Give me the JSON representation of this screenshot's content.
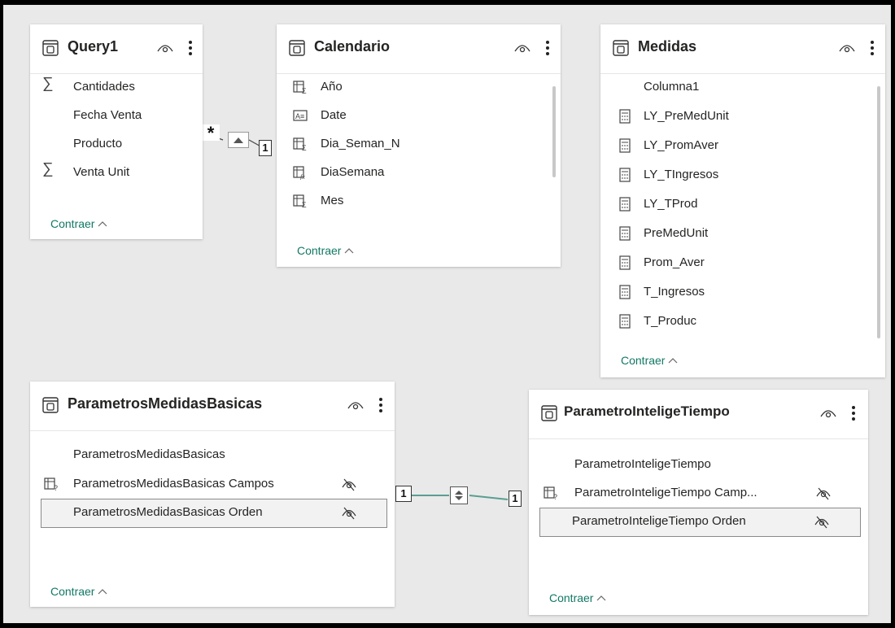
{
  "tables": {
    "query1": {
      "title": "Query1",
      "fields": [
        {
          "label": "Cantidades",
          "icon": "sigma-icon"
        },
        {
          "label": "Fecha Venta",
          "icon": ""
        },
        {
          "label": "Producto",
          "icon": ""
        },
        {
          "label": "Venta Unit",
          "icon": "sigma-icon"
        }
      ],
      "collapse": "Contraer"
    },
    "calendario": {
      "title": "Calendario",
      "fields": [
        {
          "label": "Año",
          "icon": "calculated-column-icon"
        },
        {
          "label": "Date",
          "icon": "text-field-icon"
        },
        {
          "label": "Dia_Seman_N",
          "icon": "calculated-column-icon"
        },
        {
          "label": "DiaSemana",
          "icon": "formula-column-icon"
        },
        {
          "label": "Mes",
          "icon": "calculated-column-icon"
        }
      ],
      "collapse": "Contraer"
    },
    "medidas": {
      "title": "Medidas",
      "fields": [
        {
          "label": "Columna1",
          "icon": ""
        },
        {
          "label": "LY_PreMedUnit",
          "icon": "measure-icon"
        },
        {
          "label": "LY_PromAver",
          "icon": "measure-icon"
        },
        {
          "label": "LY_TIngresos",
          "icon": "measure-icon"
        },
        {
          "label": "LY_TProd",
          "icon": "measure-icon"
        },
        {
          "label": "PreMedUnit",
          "icon": "measure-icon"
        },
        {
          "label": "Prom_Aver",
          "icon": "measure-icon"
        },
        {
          "label": "T_Ingresos",
          "icon": "measure-icon"
        },
        {
          "label": "T_Produc",
          "icon": "measure-icon"
        }
      ],
      "collapse": "Contraer"
    },
    "parametros_medidas_basicas": {
      "title": "ParametrosMedidasBasicas",
      "fields": [
        {
          "label": "ParametrosMedidasBasicas",
          "icon": "",
          "hidden": false
        },
        {
          "label": "ParametrosMedidasBasicas Campos",
          "icon": "field-parameter-icon",
          "hidden": true
        },
        {
          "label": "ParametrosMedidasBasicas Orden",
          "icon": "",
          "hidden": true,
          "selected": true
        }
      ],
      "collapse": "Contraer"
    },
    "parametro_intelige_tiempo": {
      "title": "ParametroInteligeTiempo",
      "fields": [
        {
          "label": "ParametroInteligeTiempo",
          "icon": "",
          "hidden": false
        },
        {
          "label": "ParametroInteligeTiempo Camp...",
          "icon": "field-parameter-icon",
          "hidden": true
        },
        {
          "label": "ParametroInteligeTiempo Orden",
          "icon": "",
          "hidden": true,
          "selected": true
        }
      ],
      "collapse": "Contraer"
    }
  },
  "relationships": [
    {
      "from": "Query1",
      "to": "Calendario",
      "from_cardinality": "*",
      "to_cardinality": "1",
      "direction": "single"
    },
    {
      "from": "ParametrosMedidasBasicas",
      "to": "ParametroInteligeTiempo",
      "from_cardinality": "1",
      "to_cardinality": "1",
      "direction": "both"
    }
  ],
  "colors": {
    "accent": "#117865",
    "canvas": "#e9e9e9",
    "relationship_line": "#5a9e93"
  },
  "icons": {
    "table": "table-icon",
    "visibility": "eye-icon",
    "more": "more-options-icon",
    "hidden": "eye-off-icon"
  }
}
